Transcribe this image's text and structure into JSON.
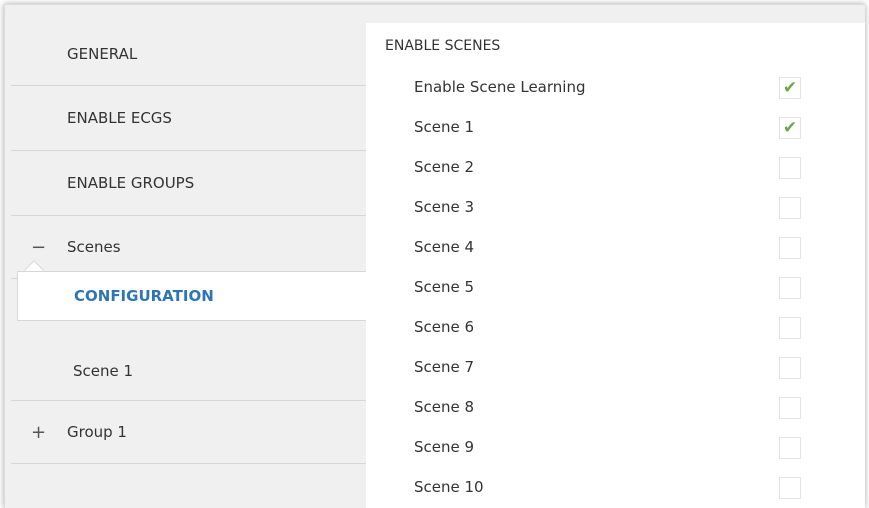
{
  "sidebar": {
    "items": [
      {
        "label": "GENERAL"
      },
      {
        "label": "ENABLE ECGS"
      },
      {
        "label": "ENABLE GROUPS"
      },
      {
        "label": "Scenes",
        "expander": "−"
      },
      {
        "label": "CONFIGURATION",
        "selected": true
      },
      {
        "label": "Scene 1"
      },
      {
        "label": "Group 1",
        "expander": "+"
      }
    ]
  },
  "main": {
    "section_title": "ENABLE SCENES",
    "options": [
      {
        "label": "Enable Scene Learning",
        "checked": true,
        "mark": "✔"
      },
      {
        "label": "Scene 1",
        "checked": true,
        "mark": "✔"
      },
      {
        "label": "Scene 2",
        "checked": false,
        "mark": ""
      },
      {
        "label": "Scene 3",
        "checked": false,
        "mark": ""
      },
      {
        "label": "Scene 4",
        "checked": false,
        "mark": ""
      },
      {
        "label": "Scene 5",
        "checked": false,
        "mark": ""
      },
      {
        "label": "Scene 6",
        "checked": false,
        "mark": ""
      },
      {
        "label": "Scene 7",
        "checked": false,
        "mark": ""
      },
      {
        "label": "Scene 8",
        "checked": false,
        "mark": ""
      },
      {
        "label": "Scene 9",
        "checked": false,
        "mark": ""
      },
      {
        "label": "Scene 10",
        "checked": false,
        "mark": ""
      }
    ]
  },
  "colors": {
    "accent": "#2e75b6",
    "check": "#6aaa4f",
    "sidebar_bg": "#f0f0f0"
  },
  "icons": {
    "collapse": "minus-icon",
    "expand": "plus-icon",
    "checked": "checkmark-icon"
  }
}
